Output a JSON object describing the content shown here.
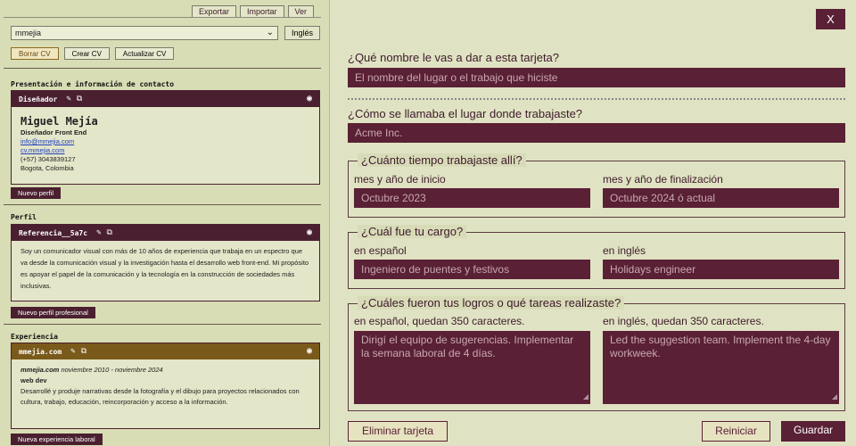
{
  "left": {
    "menu": [
      "Exportar",
      "Importar",
      "Ver"
    ],
    "select_value": "mmejia",
    "lang_button": "Inglés",
    "buttons": [
      "Borrar CV",
      "Crear CV",
      "Actualizar CV"
    ],
    "sec1_title": "Presentación e información de contacto",
    "profile_card": {
      "title": "Diseñador",
      "name": "Miguel Mejía",
      "role": "Diseñador Front End",
      "email": "info@mmejia.com",
      "site": "cv.mmejia.com",
      "phone": "(+57) 3043839127",
      "city": "Bogota, Colombia"
    },
    "new_profile": "Nuevo perfil",
    "sec2_title": "Perfil",
    "ref_card": {
      "title": "Referencia__5a7c",
      "text": "Soy un comunicador visual con más de 10 años de experiencia que trabaja en un espectro que va desde la comunicación visual y la investigación hasta el desarrollo web front-end. Mi propósito es apoyar el papel de la comunicación y la tecnología en la construcción de sociedades más inclusivas."
    },
    "new_pro_profile": "Nuevo perfil profesional",
    "sec3_title": "Experiencia",
    "exp_card": {
      "title": "mmejia.com",
      "company": "mmejia.com",
      "dates": "noviembre 2010 - noviembre 2024",
      "role": "web dev",
      "text": "Desarrollé y produje narrativas desde la fotografía y el dibujo para proyectos relacionados con cultura, trabajo, educación, reincorporación y acceso a la información."
    },
    "new_exp": "Nueva experiencia laboral"
  },
  "right": {
    "close": "X",
    "q1": "¿Qué nombre le vas a dar a esta tarjeta?",
    "q1_placeholder": "El nombre del lugar o el trabajo que hiciste",
    "q2": "¿Cómo se llamaba el lugar donde trabajaste?",
    "q2_placeholder": "Acme Inc.",
    "q3": "¿Cuánto tiempo trabajaste allí?",
    "start_label": "mes y año de inicio",
    "start_placeholder": "Octubre 2023",
    "end_label": "mes y año de finalización",
    "end_placeholder": "Octubre 2024 ó actual",
    "q4": "¿Cuál fue tu cargo?",
    "es_label": "en español",
    "es_placeholder": "Ingeniero de puentes y festivos",
    "en_label": "en inglés",
    "en_placeholder": "Holidays engineer",
    "q5": "¿Cuáles fueron tus logros o qué tareas realizaste?",
    "ach_es_label": "en español, quedan 350 caracteres.",
    "ach_es_placeholder": "Dirigí el equipo de sugerencias. Implementar la semana laboral de 4 días.",
    "ach_en_label": "en inglés, quedan 350 caracteres.",
    "ach_en_placeholder": "Led the suggestion team. Implement the 4-day workweek.",
    "delete": "Eliminar tarjeta",
    "reset": "Reiniciar",
    "save": "Guardar"
  },
  "colors": {
    "accent": "#5a2035",
    "bg": "#e0e3c3",
    "gold": "#7a5a1a"
  }
}
